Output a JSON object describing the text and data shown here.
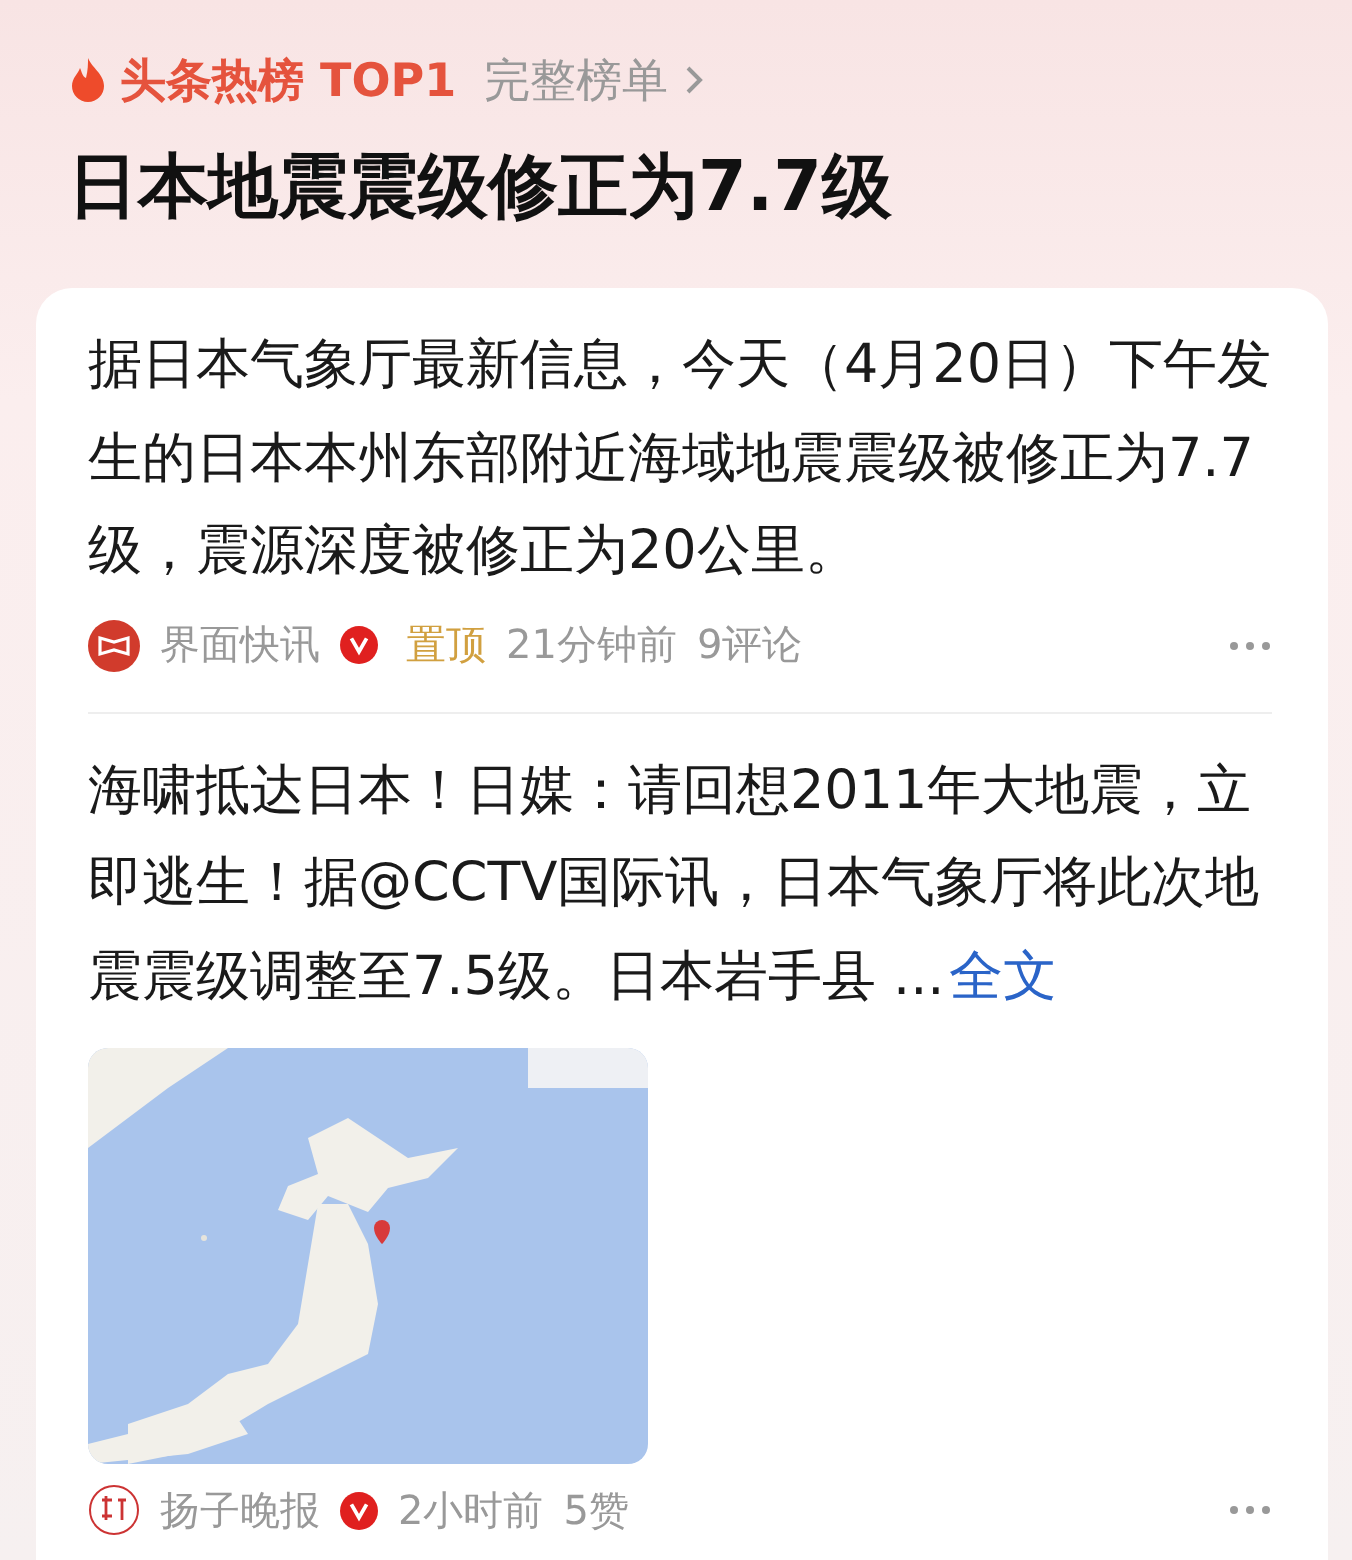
{
  "hot_list": {
    "label": "头条热榜 TOP1",
    "link": "完整榜单"
  },
  "title": "日本地震震级修正为7.7级",
  "posts": [
    {
      "text": "据日本气象厅最新信息，今天（4月20日）下午发生的日本本州东部附近海域地震震级被修正为7.7级，震源深度被修正为20公里。",
      "source": "界面快讯",
      "avatar": {
        "kind": "frame"
      },
      "verified": true,
      "pinned": "置顶",
      "time": "21分钟前",
      "stat": "9评论"
    },
    {
      "text": "海啸抵达日本！日媒：请回想2011年大地震，立即逃生！据@CCTV国际讯，日本气象厅将此次地震震级调整至7.5级。日本岩手县 ...",
      "more": "全文",
      "source": "扬子晚报",
      "avatar": {
        "kind": "seal"
      },
      "verified": true,
      "time": "2小时前",
      "stat": "5赞"
    }
  ]
}
